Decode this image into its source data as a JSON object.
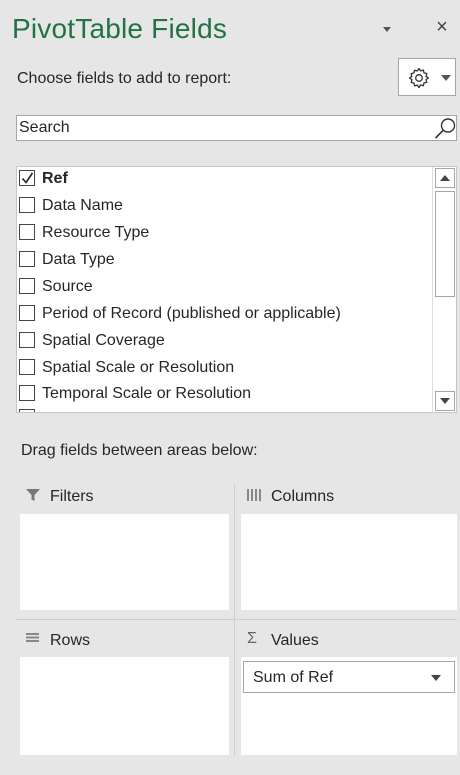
{
  "header": {
    "title": "PivotTable Fields",
    "close_glyph": "×"
  },
  "choose_label": "Choose fields to add to report:",
  "search": {
    "placeholder": "Search"
  },
  "fields": [
    {
      "label": "Ref",
      "checked": true
    },
    {
      "label": "Data Name",
      "checked": false
    },
    {
      "label": "Resource Type",
      "checked": false
    },
    {
      "label": "Data Type",
      "checked": false
    },
    {
      "label": "Source",
      "checked": false
    },
    {
      "label": "Period of Record (published or applicable)",
      "checked": false
    },
    {
      "label": "Spatial Coverage",
      "checked": false
    },
    {
      "label": "Spatial Scale or Resolution",
      "checked": false
    },
    {
      "label": "Temporal Scale or Resolution",
      "checked": false
    }
  ],
  "drag_label": "Drag fields between areas below:",
  "areas": {
    "filters": {
      "label": "Filters",
      "icon": "filter-icon"
    },
    "columns": {
      "label": "Columns",
      "icon": "columns-icon"
    },
    "rows": {
      "label": "Rows",
      "icon": "rows-icon"
    },
    "values": {
      "label": "Values",
      "icon": "sigma-icon",
      "items": [
        {
          "label": "Sum of Ref"
        }
      ]
    }
  },
  "colors": {
    "title": "#217346",
    "panel": "#e6e6e6"
  }
}
